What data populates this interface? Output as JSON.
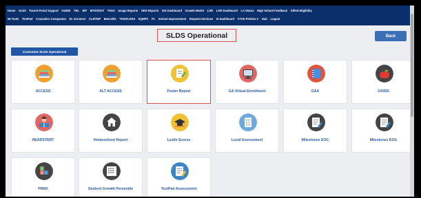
{
  "nav": {
    "row1": [
      "Home",
      "SLDS",
      "Parent Portal Support",
      "GUIDE",
      "TRL",
      "IEP",
      "MTSS/SST",
      "TKES",
      "Usage Reports",
      "ODS Reports",
      "SIS Dashboard",
      "Growth Model",
      "LOR",
      "LOR Dashboard",
      "LA Status",
      "High School Feedback",
      "Gifted Eligibility"
    ],
    "row2": [
      "MI Tools",
      "TestPad",
      "Counselor Companion",
      "EL Screener",
      "CLIP/SIP",
      "Beenville",
      "TKES/LKES",
      "EQHPC",
      "PL",
      "School Improvement",
      "Request Services",
      "SI Dashboard",
      "CTAE Perkins V",
      "Hub",
      "Logout"
    ]
  },
  "page": {
    "title": "SLDS Operational",
    "back_label": "Back",
    "customize_label": "Customize SLDS Operational"
  },
  "tiles": [
    {
      "label": "ACCESS",
      "icon": "books-icon"
    },
    {
      "label": "ALT ACCESS",
      "icon": "books-icon"
    },
    {
      "label": "Foster Report",
      "icon": "report-pencil-icon"
    },
    {
      "label": "GA Virtual Enrollment",
      "icon": "computer-monitor-icon"
    },
    {
      "label": "GAA",
      "icon": "notebook-icon"
    },
    {
      "label": "GKIDS",
      "icon": "apple-icon"
    },
    {
      "label": "HEADSTART",
      "icon": "reading-child-icon"
    },
    {
      "label": "Homeschool Report",
      "icon": "house-icon"
    },
    {
      "label": "Lexile Scores",
      "icon": "graduation-cap-icon"
    },
    {
      "label": "Local Assessment",
      "icon": "checklist-icon"
    },
    {
      "label": "Milestones EOC",
      "icon": "document-pencil-icon"
    },
    {
      "label": "Milestones EOG",
      "icon": "document-pencil-icon"
    },
    {
      "label": "PREK",
      "icon": "abc-blocks-icon"
    },
    {
      "label": "Student Growth Percentile",
      "icon": "calendar-grid-icon"
    },
    {
      "label": "TestPad Assessment",
      "icon": "test-pencil-icon"
    }
  ],
  "colors": {
    "nav_bg": "#0a2f6b",
    "accent": "#2255a4",
    "highlight_border": "#d9534f",
    "tile_label": "#2a5aa8"
  }
}
